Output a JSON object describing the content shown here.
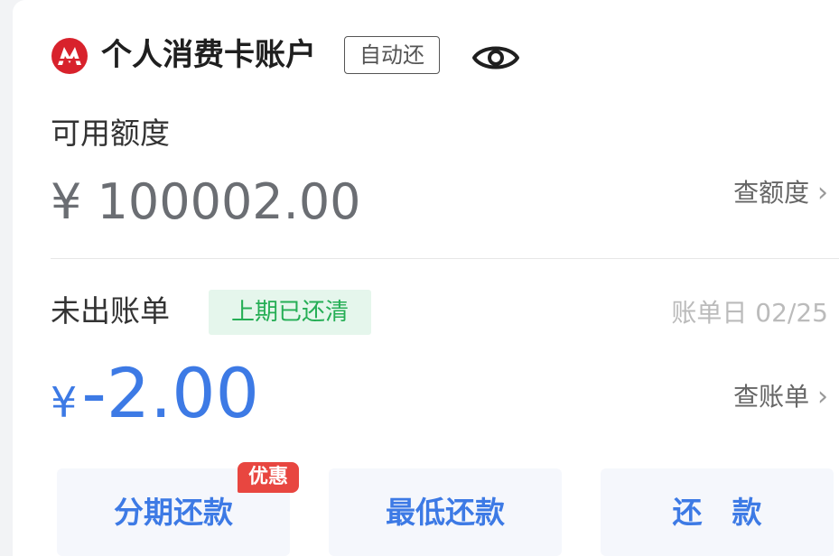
{
  "account": {
    "title": "个人消费卡账户",
    "auto_repay_badge": "自动还",
    "logo_icon": "bank-logo-icon",
    "visibility_icon": "eye-icon"
  },
  "credit": {
    "label": "可用额度",
    "amount": "¥ 100002.00",
    "link": "查额度"
  },
  "bill": {
    "label": "未出账单",
    "status_badge": "上期已还清",
    "bill_date": "账单日 02/25",
    "currency": "¥",
    "amount": "-2.00",
    "link": "查账单"
  },
  "actions": {
    "installment": "分期还款",
    "promo_badge": "优惠",
    "minimum": "最低还款",
    "repay": "还　款"
  },
  "colors": {
    "accent": "#3d7ae5",
    "brand_red": "#d8222c",
    "success": "#25ae55",
    "promo": "#e84640"
  }
}
